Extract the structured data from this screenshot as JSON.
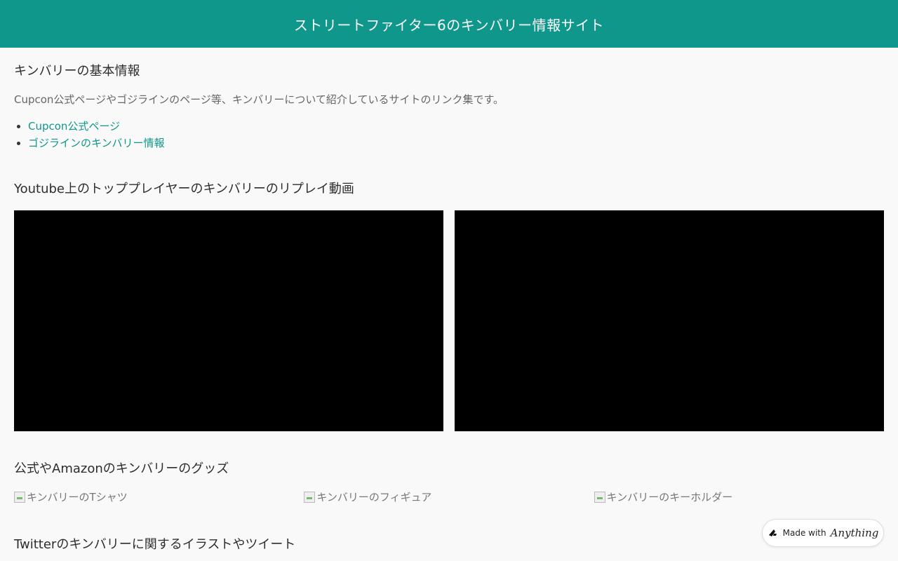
{
  "header": {
    "title": "ストリートファイター6のキンバリー情報サイト"
  },
  "basic_info": {
    "title": "キンバリーの基本情報",
    "description": "Cupcon公式ページやゴジラインのページ等、キンバリーについて紹介しているサイトのリンク集です。",
    "links": [
      {
        "label": "Cupcon公式ページ"
      },
      {
        "label": "ゴジラインのキンバリー情報"
      }
    ]
  },
  "videos": {
    "title": "Youtube上のトッププレイヤーのキンバリーのリプレイ動画"
  },
  "goods": {
    "title": "公式やAmazonのキンバリーのグッズ",
    "items": [
      {
        "alt": "キンバリーのTシャツ"
      },
      {
        "alt": "キンバリーのフィギュア"
      },
      {
        "alt": "キンバリーのキーホルダー"
      }
    ]
  },
  "twitter": {
    "title": "Twitterのキンバリーに関するイラストやツイート"
  },
  "badge": {
    "made_with": "Made with",
    "brand": "Anything"
  },
  "colors": {
    "accent": "#0f978b",
    "background": "#f8f9f8"
  }
}
